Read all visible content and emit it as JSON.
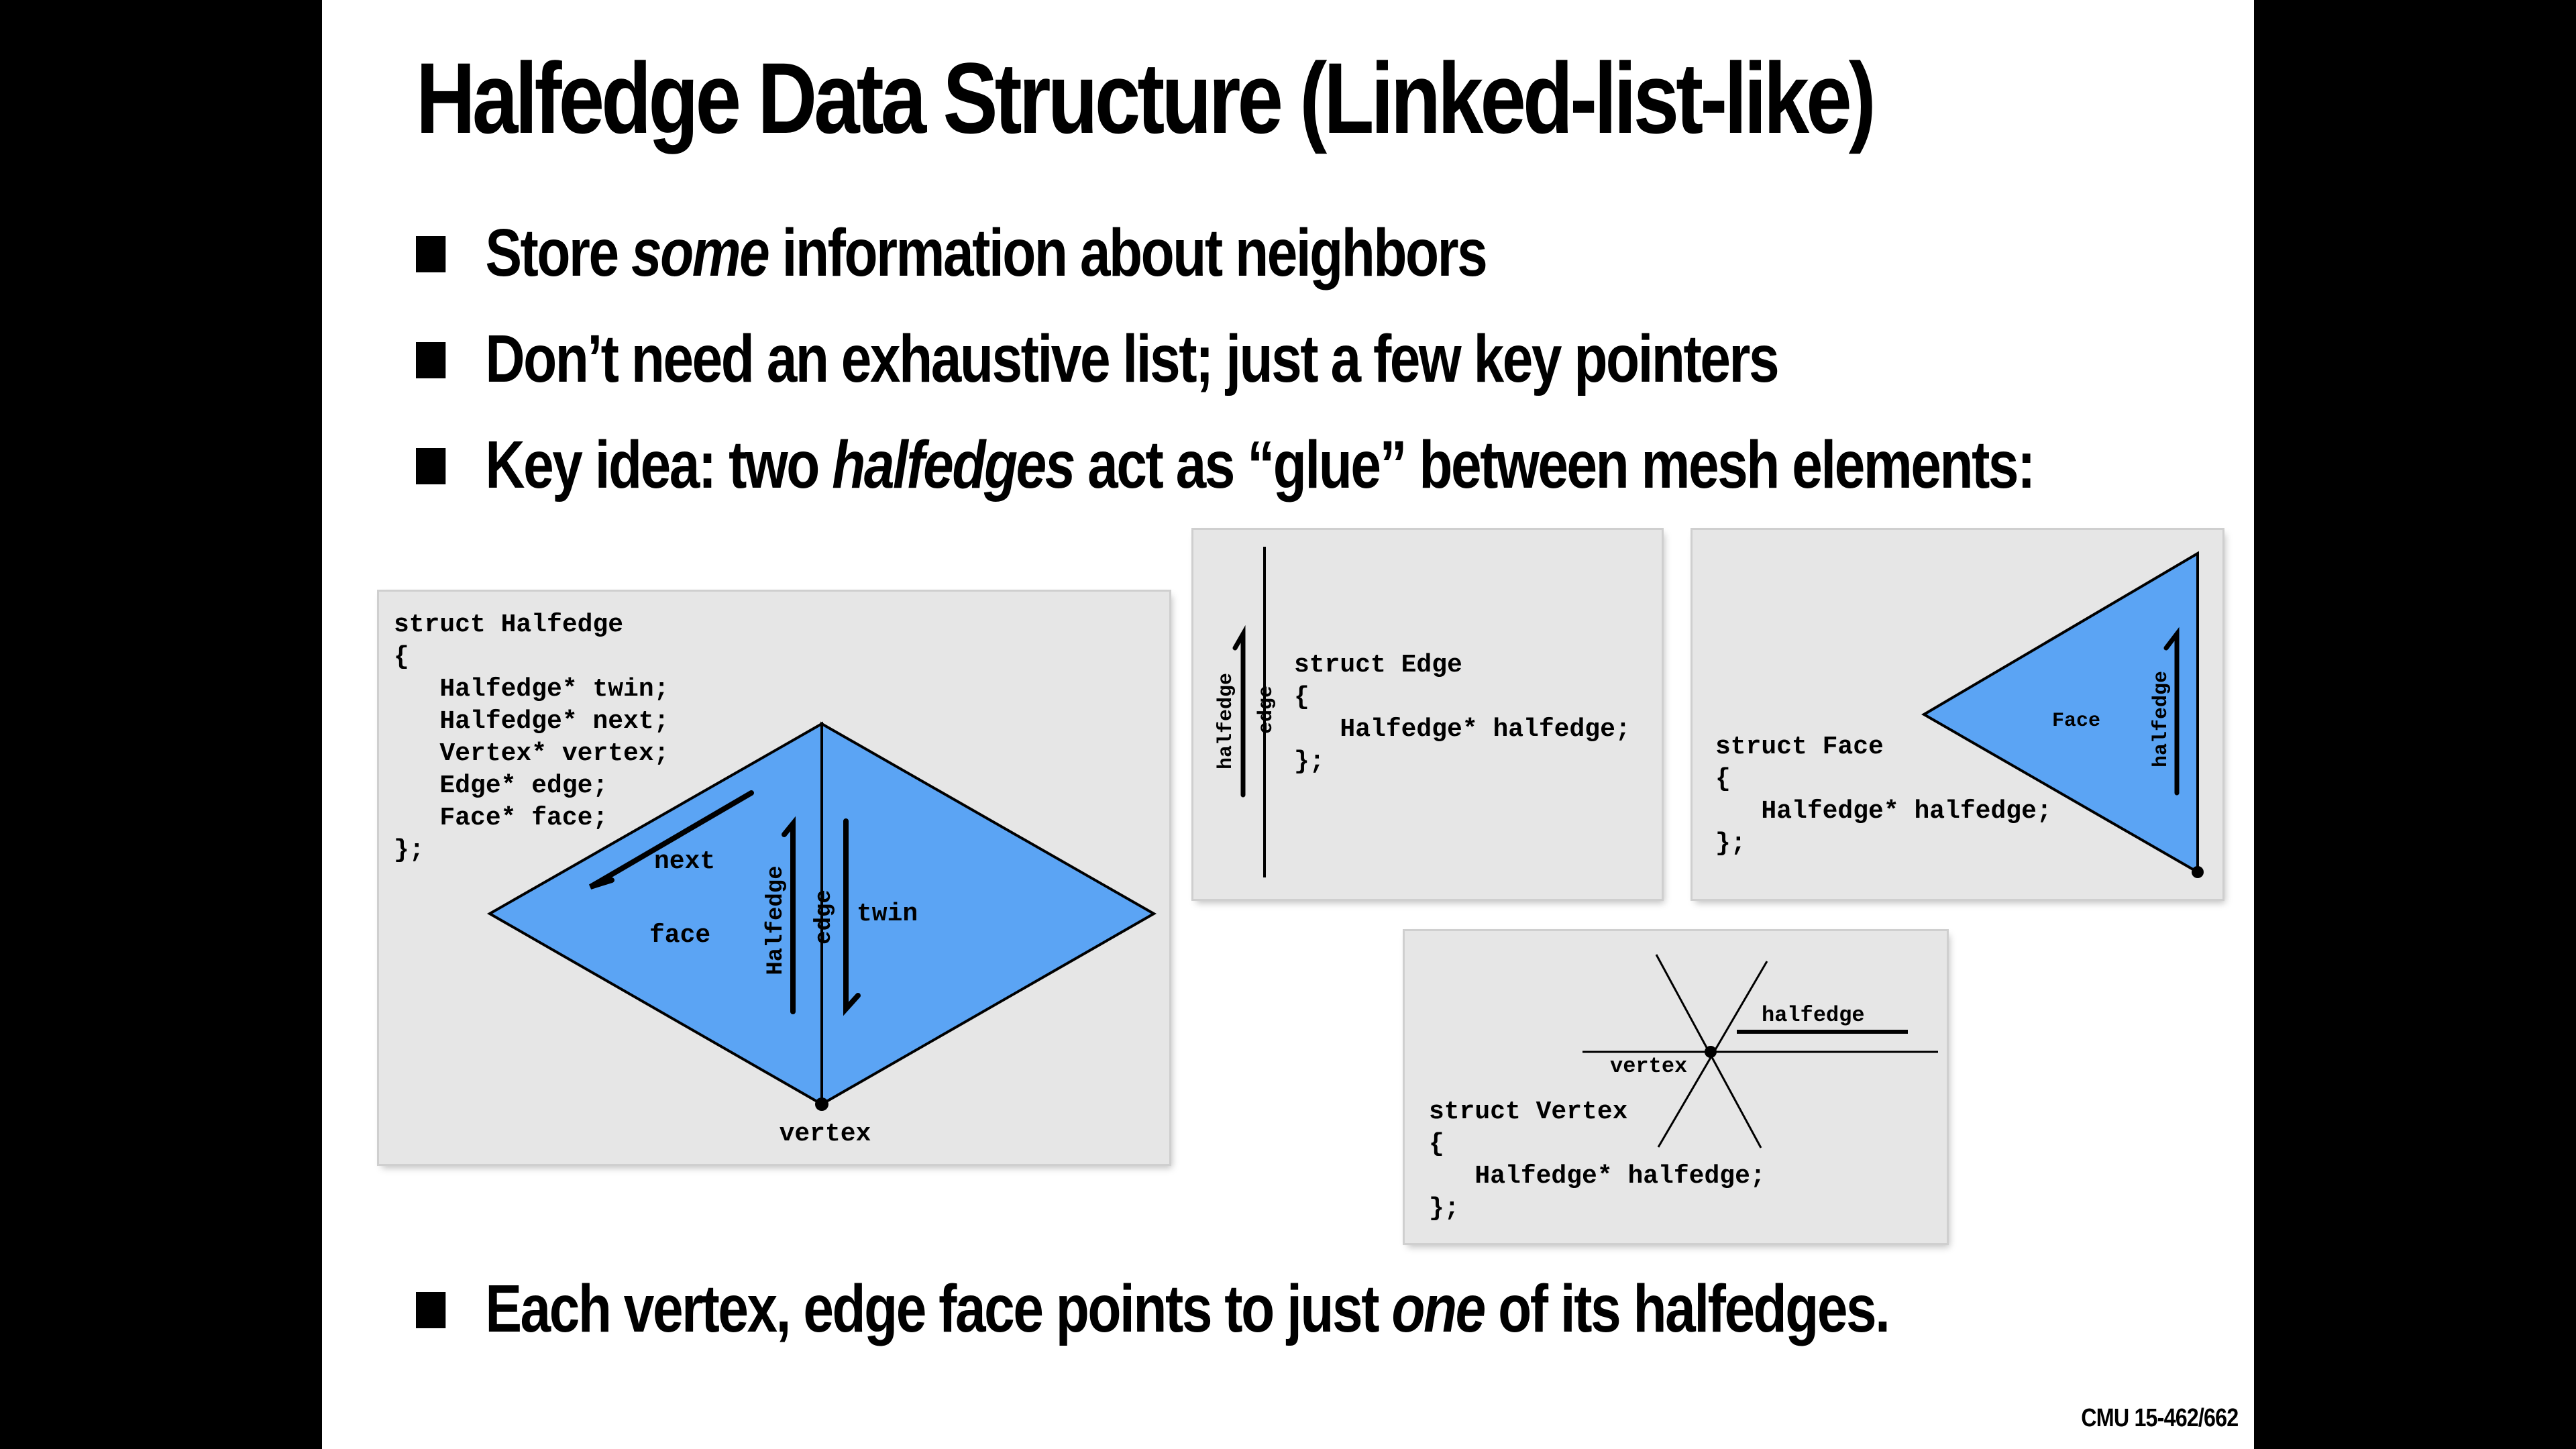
{
  "title": "Halfedge Data Structure (Linked-list-like)",
  "bullets": [
    {
      "before": "Store ",
      "em": "some",
      "after": " information about neighbors"
    },
    {
      "before": "Don’t need an exhaustive list; just a few key pointers",
      "em": "",
      "after": ""
    },
    {
      "before": "Key idea: two ",
      "em": "halfedges",
      "after": " act as “glue” between mesh elements:"
    },
    {
      "before": "Each vertex, edge face points to just ",
      "em": "one",
      "after": " of its halfedges."
    }
  ],
  "halfedge_panel": {
    "code": "struct Halfedge\n{\n   Halfedge* twin;\n   Halfedge* next;\n   Vertex* vertex;\n   Edge* edge;\n   Face* face;\n};",
    "labels": {
      "next": "next",
      "face": "face",
      "halfedge": "Halfedge",
      "edge": "edge",
      "twin": "twin",
      "vertex": "vertex"
    }
  },
  "edge_panel": {
    "code": "struct Edge\n{\n   Halfedge* halfedge;\n};",
    "labels": {
      "halfedge": "halfedge",
      "edge": "edge"
    }
  },
  "face_panel": {
    "code": "struct Face\n{\n   Halfedge* halfedge;\n};",
    "labels": {
      "face": "Face",
      "halfedge": "halfedge"
    }
  },
  "vertex_panel": {
    "code": "struct Vertex\n{\n   Halfedge* halfedge;\n};",
    "labels": {
      "halfedge": "halfedge",
      "vertex": "vertex"
    }
  },
  "footer": "CMU 15-462/662",
  "colors": {
    "face_fill": "#5ba4f4",
    "panel_bg": "#e6e6e6",
    "slide_bg": "#ffffff",
    "frame_bg": "#000000"
  }
}
